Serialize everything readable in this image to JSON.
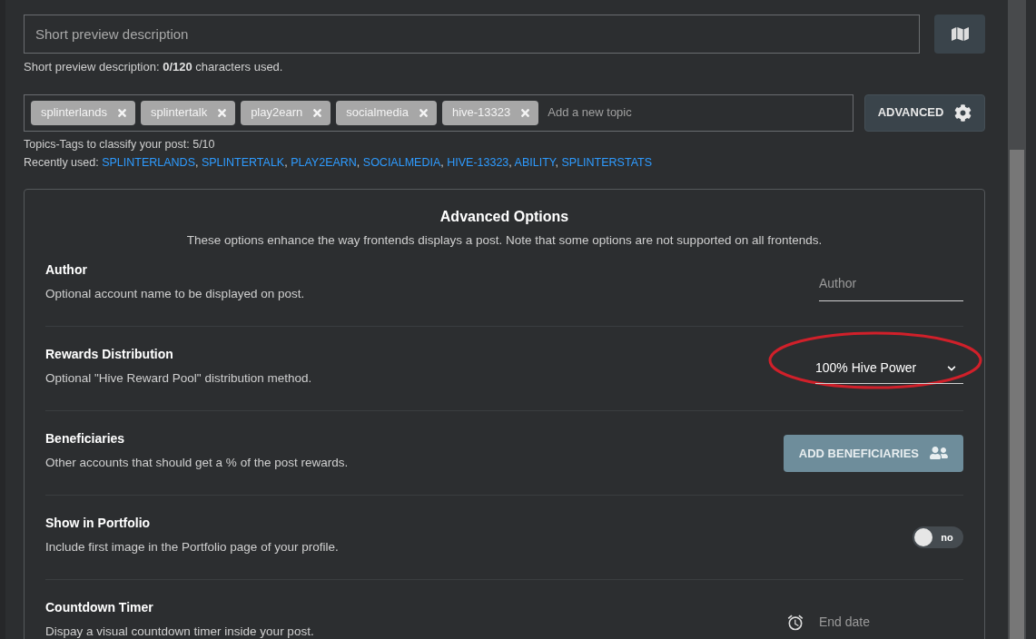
{
  "description_field": {
    "placeholder": "Short preview description"
  },
  "description_hint": {
    "label": "Short preview description: ",
    "count": "0/120",
    "suffix": " characters used."
  },
  "topics": {
    "tags": [
      {
        "label": "splinterlands"
      },
      {
        "label": "splintertalk"
      },
      {
        "label": "play2earn"
      },
      {
        "label": "socialmedia"
      },
      {
        "label": "hive-13323"
      }
    ],
    "placeholder": "Add a new topic",
    "advanced_button": "ADVANCED",
    "hint": "Topics-Tags to classify your post: 5/10",
    "recent_label": "Recently used: ",
    "recent_separator": ", ",
    "recent": [
      "SPLINTERLANDS",
      "SPLINTERTALK",
      "PLAY2EARN",
      "SOCIALMEDIA",
      "HIVE-13323",
      "ABILITY",
      "SPLINTERSTATS"
    ]
  },
  "advanced": {
    "title": "Advanced Options",
    "subtitle": "These options enhance the way frontends displays a post. Note that some options are not supported on all frontends.",
    "options": [
      {
        "kind": "text",
        "label": "Author",
        "description": "Optional account name to be displayed on post.",
        "placeholder": "Author"
      },
      {
        "kind": "select",
        "label": "Rewards Distribution",
        "description": "Optional \"Hive Reward Pool\" distribution method.",
        "value": "100% Hive Power",
        "highlighted": true
      },
      {
        "kind": "button",
        "label": "Beneficiaries",
        "description": "Other accounts that should get a % of the post rewards.",
        "button": "ADD BENEFICIARIES"
      },
      {
        "kind": "toggle",
        "label": "Show in Portfolio",
        "description": "Include first image in the Portfolio page of your profile.",
        "on": false,
        "state_text": "no"
      },
      {
        "kind": "date",
        "label": "Countdown Timer",
        "description": "Dispay a visual countdown timer inside your post.",
        "placeholder": "End date"
      }
    ]
  }
}
